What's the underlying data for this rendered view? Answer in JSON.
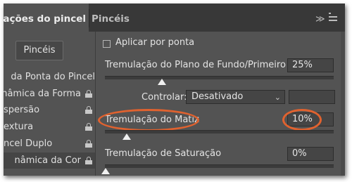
{
  "tabs": {
    "active": "urações do pincel",
    "second": "Pincéis"
  },
  "header_icons": [
    "collapse-icon",
    "panel-menu-icon"
  ],
  "left": {
    "brushes_button": "Pincéis",
    "items": [
      {
        "label": "da Ponta do Pincel",
        "locked": false,
        "selected": false
      },
      {
        "label": "nâmica da Forma",
        "locked": true,
        "selected": false
      },
      {
        "label": "spersão",
        "locked": true,
        "selected": false
      },
      {
        "label": "extura",
        "locked": true,
        "selected": false
      },
      {
        "label": "ncel Duplo",
        "locked": true,
        "selected": false
      },
      {
        "label": "nâmica da Cor",
        "locked": true,
        "selected": true
      }
    ]
  },
  "main": {
    "apply_per_tip": "Aplicar por ponta",
    "fg_bg_jitter": {
      "label": "Tremulação do Plano de Fundo/Primeiro Plano",
      "value": "25%",
      "level": 0.25
    },
    "control": {
      "label": "Controlar:",
      "value": "Desativado"
    },
    "hue_jitter": {
      "label": "Tremulação do Matiz",
      "value": "10%",
      "level": 0.1
    },
    "saturation_jitter": {
      "label": "Tremulação de Saturação",
      "value": "0%",
      "level": 0.0
    }
  },
  "colors": {
    "panel_bg": "#535353",
    "tabbar_bg": "#383838",
    "highlight_ring": "#e0622f"
  }
}
